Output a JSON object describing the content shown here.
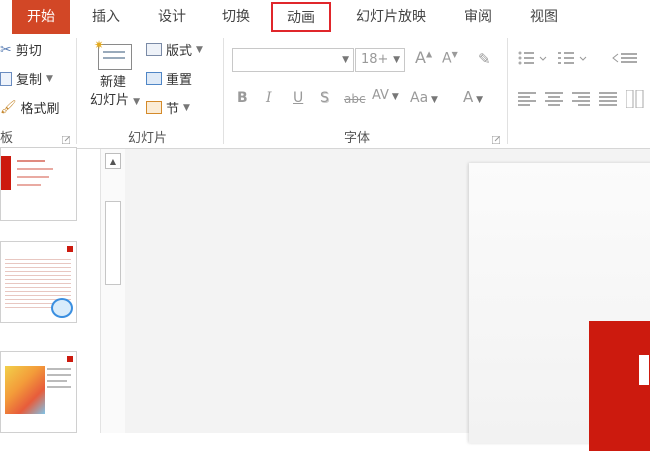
{
  "tabs": [
    {
      "label": "开始",
      "active": true
    },
    {
      "label": "插入"
    },
    {
      "label": "设计"
    },
    {
      "label": "切换"
    },
    {
      "label": "动画",
      "highlighted": true
    },
    {
      "label": "幻灯片放映"
    },
    {
      "label": "审阅"
    },
    {
      "label": "视图"
    }
  ],
  "clipboard": {
    "cut": "剪切",
    "copy": "复制",
    "format_painter": "格式刷",
    "group_label": "板"
  },
  "slides": {
    "new_slide_line1": "新建",
    "new_slide_line2": "幻灯片",
    "layout": "版式",
    "reset": "重置",
    "section": "节",
    "group_label": "幻灯片"
  },
  "font": {
    "size_value": "18+",
    "bold": "B",
    "italic": "I",
    "underline": "U",
    "shadow": "S",
    "strikethrough": "abc",
    "spacing": "AV",
    "change_case": "Aa",
    "font_color": "A",
    "grow": "A",
    "shrink": "A",
    "group_label": "字体"
  },
  "colors": {
    "accent": "#d24726",
    "highlight_border": "#e0262b",
    "slide_red": "#cc1a0e"
  }
}
